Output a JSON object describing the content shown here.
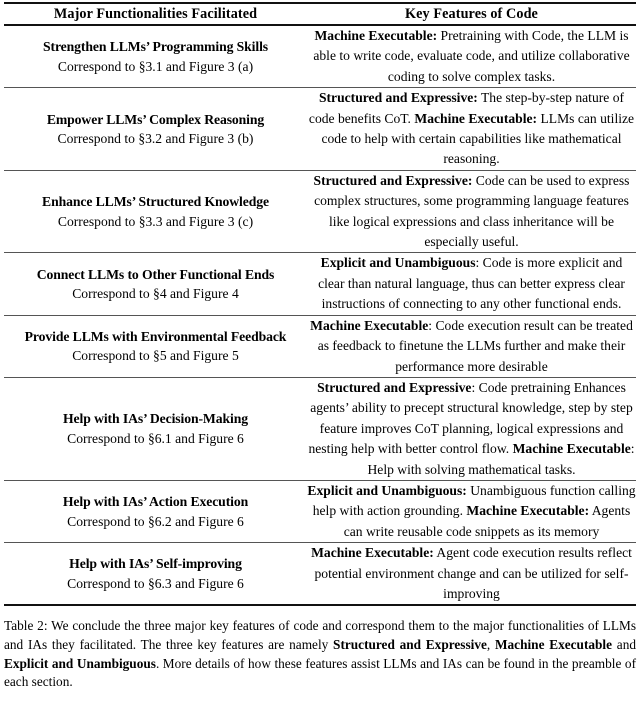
{
  "table": {
    "headers": {
      "left": "Major Functionalities Facilitated",
      "right": "Key Features of Code"
    },
    "rows": [
      {
        "id": "strengthen-programming-skills",
        "left_title": "Strengthen LLMs’ Programming Skills",
        "left_sub": "Correspond to §3.1 and Figure 3 (a)",
        "right_segments": [
          {
            "bold": true,
            "text": "Machine Executable:"
          },
          {
            "bold": false,
            "text": " Pretraining with Code, the LLM is able to write code, evaluate code, and utilize collaborative coding to solve complex tasks."
          }
        ]
      },
      {
        "id": "empower-complex-reasoning",
        "left_title": "Empower LLMs’ Complex Reasoning",
        "left_sub": "Correspond to §3.2 and Figure 3 (b)",
        "right_segments": [
          {
            "bold": true,
            "text": "Structured and Expressive:"
          },
          {
            "bold": false,
            "text": " The step-by-step nature of code benefits CoT. "
          },
          {
            "bold": true,
            "text": "Machine Executable:"
          },
          {
            "bold": false,
            "text": " LLMs can utilize code to help with certain capabilities like mathematical reasoning."
          }
        ]
      },
      {
        "id": "enhance-structured-knowledge",
        "left_title": "Enhance LLMs’ Structured Knowledge",
        "left_sub": "Correspond to §3.3 and Figure 3 (c)",
        "right_segments": [
          {
            "bold": true,
            "text": "Structured and Expressive:"
          },
          {
            "bold": false,
            "text": " Code can be used to express complex structures, some programming language features like logical expressions and class inheritance will be especially useful."
          }
        ]
      },
      {
        "id": "connect-to-other-functional-ends",
        "left_title": "Connect LLMs to Other Functional Ends",
        "left_sub": "Correspond to §4 and Figure 4",
        "right_segments": [
          {
            "bold": true,
            "text": "Explicit and Unambiguous"
          },
          {
            "bold": false,
            "text": ": Code is more explicit and clear than natural language, thus can better express clear instructions of connecting to any other functional ends."
          }
        ]
      },
      {
        "id": "provide-environmental-feedback",
        "left_title": "Provide LLMs with Environmental Feedback",
        "left_sub": "Correspond to §5 and Figure 5",
        "right_segments": [
          {
            "bold": true,
            "text": "Machine Executable"
          },
          {
            "bold": false,
            "text": ": Code execution result can be treated as feedback to finetune the LLMs further and make their performance more desirable"
          }
        ]
      },
      {
        "id": "help-decision-making",
        "left_title": "Help with IAs’ Decision-Making",
        "left_sub": "Correspond to §6.1 and Figure 6",
        "right_segments": [
          {
            "bold": true,
            "text": "Structured and Expressive"
          },
          {
            "bold": false,
            "text": ": Code pretraining Enhances agents’ ability to precept structural knowledge, step by step feature improves CoT planning, logical expressions and nesting help with better control flow. "
          },
          {
            "bold": true,
            "text": "Machine Executable"
          },
          {
            "bold": false,
            "text": ": Help with solving mathematical tasks."
          }
        ]
      },
      {
        "id": "help-action-execution",
        "left_title": "Help with IAs’ Action Execution",
        "left_sub": "Correspond to §6.2 and Figure 6",
        "right_segments": [
          {
            "bold": true,
            "text": "Explicit and Unambiguous:"
          },
          {
            "bold": false,
            "text": " Unambiguous function calling help with action grounding. "
          },
          {
            "bold": true,
            "text": "Machine Executable:"
          },
          {
            "bold": false,
            "text": " Agents can write reusable code snippets as its memory"
          }
        ]
      },
      {
        "id": "help-self-improving",
        "left_title": "Help with IAs’ Self-improving",
        "left_sub": "Correspond to §6.3 and Figure 6",
        "right_segments": [
          {
            "bold": true,
            "text": "Machine Executable:"
          },
          {
            "bold": false,
            "text": " Agent code execution results reflect potential environment change and can be utilized for self-improving"
          }
        ]
      }
    ]
  },
  "caption": {
    "segments": [
      {
        "bold": false,
        "text": "Table 2:  We conclude the three major key features of code and correspond them to the major functionalities of LLMs and IAs they facilitated. The three key features are namely "
      },
      {
        "bold": true,
        "text": "Structured and Expressive"
      },
      {
        "bold": false,
        "text": ", "
      },
      {
        "bold": true,
        "text": "Machine Executable"
      },
      {
        "bold": false,
        "text": " and "
      },
      {
        "bold": true,
        "text": "Explicit and Unambiguous"
      },
      {
        "bold": false,
        "text": ". More details of how these features assist LLMs and IAs can be found in the preamble of each section."
      }
    ]
  }
}
